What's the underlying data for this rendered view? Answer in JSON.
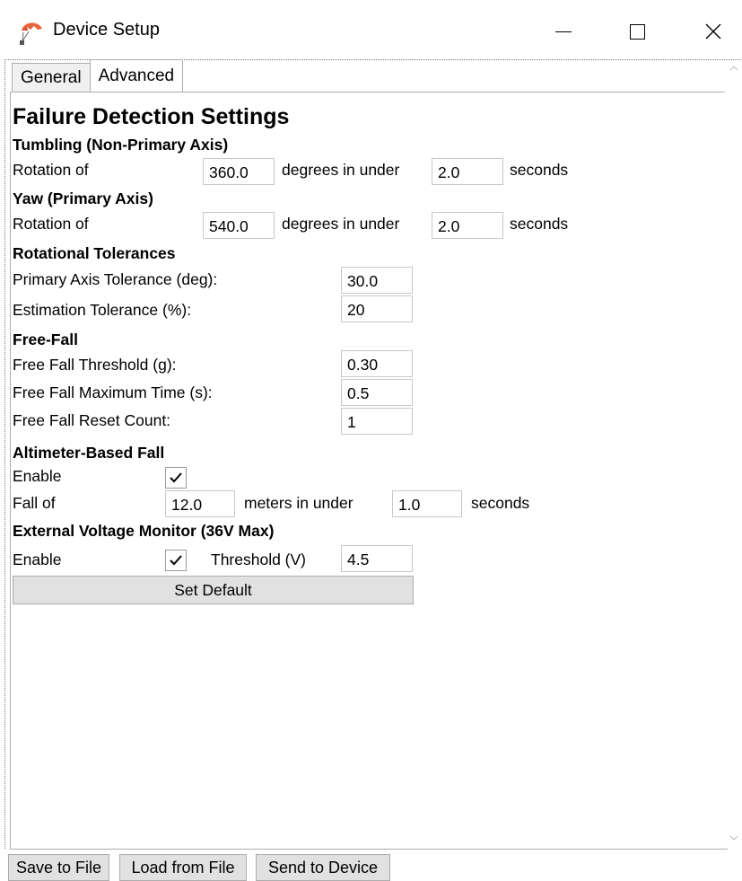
{
  "window": {
    "title": "Device Setup",
    "min_glyph": "—",
    "max_glyph": "☐",
    "close_glyph": "✕",
    "icon": "parachute-icon"
  },
  "tabs": [
    {
      "label": "General"
    },
    {
      "label": "Advanced",
      "selected": true
    }
  ],
  "heading": "Failure Detection Settings",
  "tumbling": {
    "title": "Tumbling (Non-Primary Axis)",
    "label": "Rotation of",
    "degrees": "360.0",
    "mid_text": "degrees in under",
    "seconds": "2.0",
    "unit": "seconds"
  },
  "yaw": {
    "title": "Yaw (Primary Axis)",
    "label": "Rotation of",
    "degrees": "540.0",
    "mid_text": "degrees in under",
    "seconds": "2.0",
    "unit": "seconds"
  },
  "rotational": {
    "title": "Rotational Tolerances",
    "primary_label": "Primary Axis Tolerance (deg):",
    "primary_value": "30.0",
    "estimation_label": "Estimation Tolerance (%):",
    "estimation_value": "20"
  },
  "freefall": {
    "title": "Free-Fall",
    "threshold_label": "Free Fall Threshold (g):",
    "threshold_value": "0.30",
    "max_time_label": "Free Fall Maximum Time (s):",
    "max_time_value": "0.5",
    "reset_label": "Free Fall Reset Count:",
    "reset_value": "1"
  },
  "altimeter": {
    "title": "Altimeter-Based Fall",
    "enable_label": "Enable",
    "enabled": true,
    "fall_label": "Fall of",
    "meters": "12.0",
    "mid_text": "meters in under",
    "seconds": "1.0",
    "unit": "seconds"
  },
  "voltage": {
    "title": "External Voltage Monitor (36V Max)",
    "enable_label": "Enable",
    "enabled": true,
    "threshold_label": "Threshold (V)",
    "threshold_value": "4.5"
  },
  "set_default_label": "Set Default",
  "bottom_buttons": {
    "save": "Save to File",
    "load": "Load from File",
    "send": "Send to Device"
  },
  "colors": {
    "accent_icon": "#e8643c",
    "button_bg": "#e1e1e1",
    "border": "#adadad"
  }
}
